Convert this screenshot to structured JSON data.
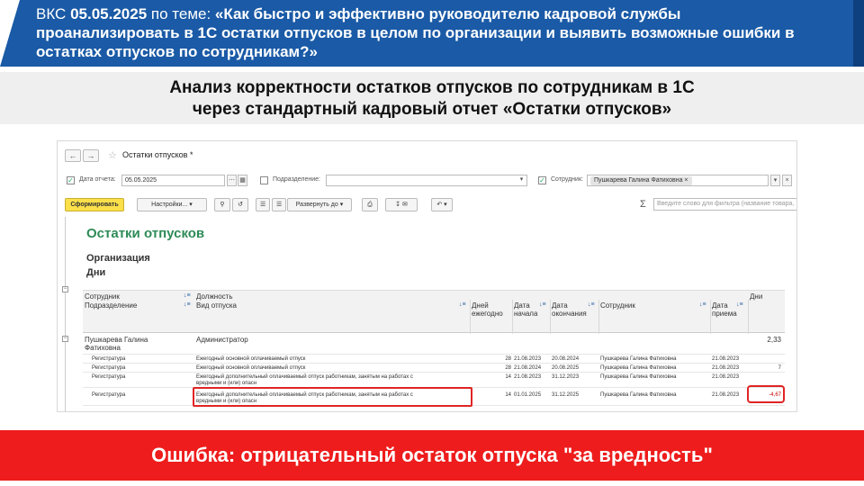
{
  "banner": {
    "prefix": "ВКС ",
    "date": "05.05.2025",
    "mid": " по теме: ",
    "topic": "«Как быстро и эффективно руководителю кадровой службы проанализировать в 1С остатки отпусков в целом по организации и выявить возможные ошибки в остатках отпусков по сотрудникам?»"
  },
  "subtitle": {
    "line1": "Анализ корректности остатков отпусков по сотрудникам в 1С",
    "line2": "через стандартный кадровый отчет «Остатки отпусков»"
  },
  "window": {
    "title": "Остатки отпусков *",
    "params": {
      "date_label": "Дата отчета:",
      "date_value": "05.05.2025",
      "division_label": "Подразделение:",
      "division_value": "",
      "employee_label": "Сотрудник:",
      "employee_value": "Пушкарева Галина Фатиховна"
    },
    "toolbar": {
      "generate": "Сформировать",
      "settings": "Настройки...",
      "expand": "Развернуть до",
      "filter_placeholder": "Введите слово для фильтра (название товара, ..."
    },
    "report": {
      "title": "Остатки отпусков",
      "group1": "Организация",
      "group2": "Дни",
      "headers": {
        "employee": "Сотрудник",
        "division": "Подразделение",
        "position": "Должность",
        "vacation_type": "Вид отпуска",
        "days_per_year": "Дней ежегодно",
        "start": "Дата начала",
        "end": "Дата окончания",
        "employee2": "Сотрудник",
        "hire_date": "Дата приема",
        "days": "Дни"
      },
      "group_row": {
        "name": "Пушкарева Галина Фатиховна",
        "position": "Администратор",
        "days": "2,33"
      },
      "rows": [
        {
          "division": "Регистратура",
          "type": "Ежегодный основной оплачиваемый отпуск",
          "type2": "",
          "per_year": "28",
          "start": "21.08.2023",
          "end": "20.08.2024",
          "employee": "Пушкарева Галина Фатиховна",
          "hire": "21.08.2023",
          "days": ""
        },
        {
          "division": "Регистратура",
          "type": "Ежегодный основной оплачиваемый отпуск",
          "type2": "",
          "per_year": "28",
          "start": "21.08.2024",
          "end": "20.08.2025",
          "employee": "Пушкарева Галина Фатиховна",
          "hire": "21.08.2023",
          "days": "7"
        },
        {
          "division": "Регистратура",
          "type": "Ежегодный дополнительный оплачиваемый отпуск работникам, занятым на работах с",
          "type2": "вредными и (или) опасн",
          "per_year": "14",
          "start": "21.08.2023",
          "end": "31.12.2023",
          "employee": "Пушкарева Галина Фатиховна",
          "hire": "21.08.2023",
          "days": ""
        },
        {
          "division": "Регистратура",
          "type": "Ежегодный дополнительный оплачиваемый отпуск работникам, занятым на работах с",
          "type2": "вредными и (или) опасн",
          "per_year": "14",
          "start": "01.01.2025",
          "end": "31.12.2025",
          "employee": "Пушкарева Галина Фатиховна",
          "hire": "21.08.2023",
          "days": "-4,67"
        }
      ]
    }
  },
  "error_message": "Ошибка: отрицательный остаток отпуска \"за вредность\"",
  "colors": {
    "banner_blue": "#1a5aa6",
    "error_red": "#ee1c1c",
    "highlight_red": "#e02424",
    "report_title_green": "#2e8b57",
    "generate_yellow": "#fbe04a"
  }
}
